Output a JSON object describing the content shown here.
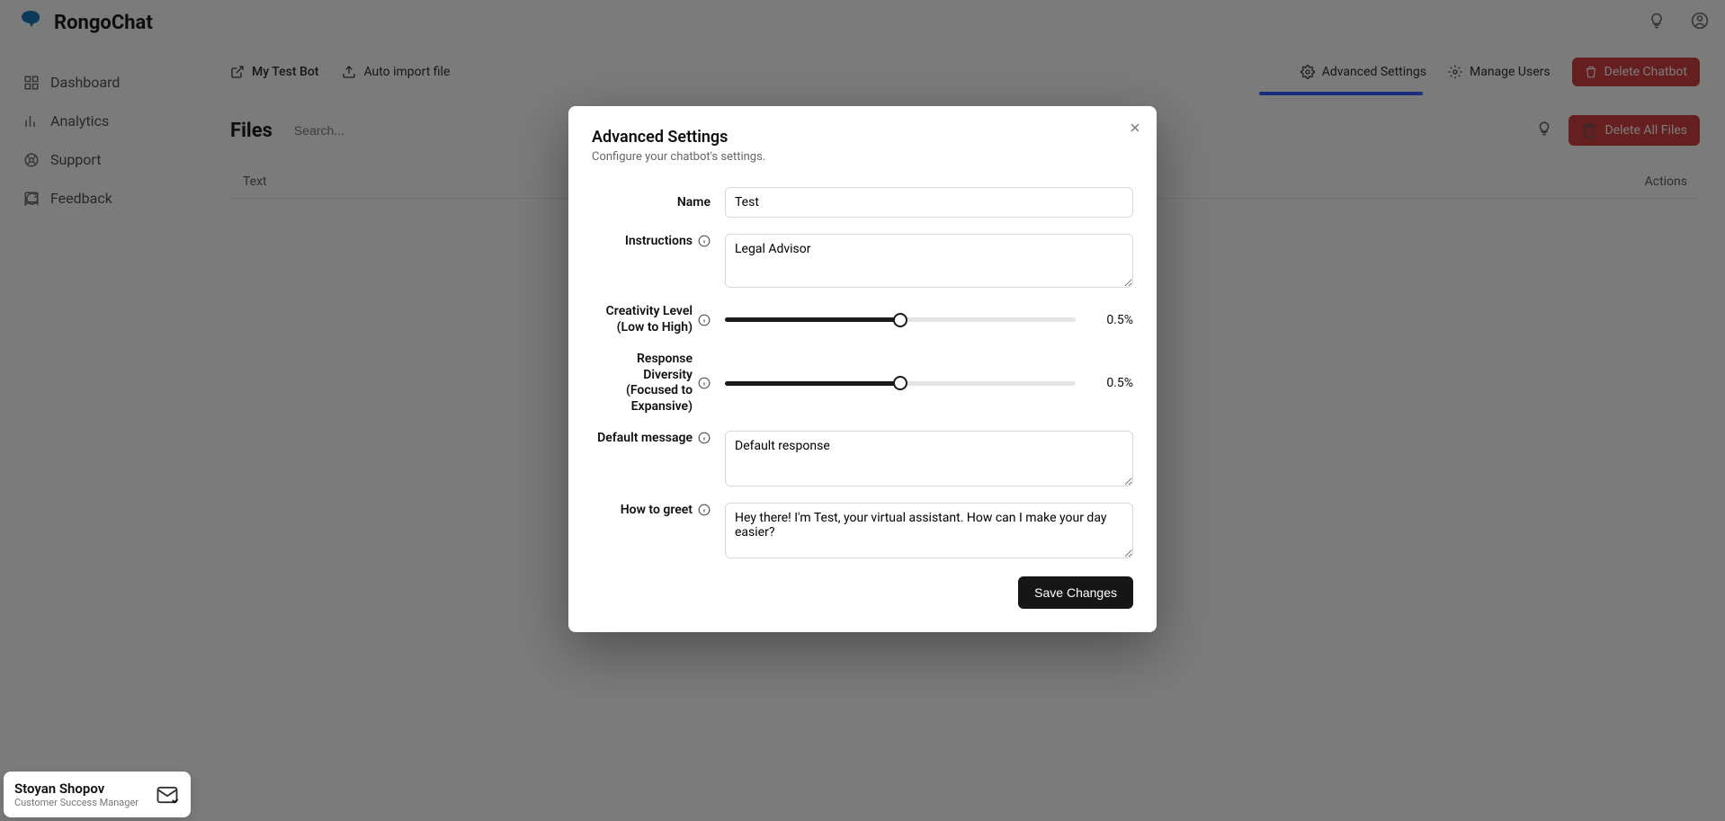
{
  "brand": {
    "name": "RongoChat"
  },
  "sidebar": {
    "items": [
      {
        "label": "Dashboard"
      },
      {
        "label": "Analytics"
      },
      {
        "label": "Support"
      },
      {
        "label": "Feedback"
      }
    ]
  },
  "header": {
    "bot_name": "My Test Bot",
    "auto_import": "Auto import file",
    "advanced_settings": "Advanced Settings",
    "manage_users": "Manage Users",
    "delete_chatbot": "Delete Chatbot"
  },
  "files": {
    "title": "Files",
    "search_placeholder": "Search...",
    "delete_all": "Delete All Files",
    "columns": {
      "text": "Text",
      "actions": "Actions"
    }
  },
  "modal": {
    "title": "Advanced Settings",
    "subtitle": "Configure your chatbot's settings.",
    "labels": {
      "name": "Name",
      "instructions": "Instructions",
      "creativity": "Creativity Level (Low to High)",
      "diversity": "Response Diversity (Focused to Expansive)",
      "default_message": "Default message",
      "how_to_greet": "How to greet"
    },
    "values": {
      "name": "Test",
      "instructions": "Legal Advisor",
      "creativity_pct": 50,
      "creativity_display": "0.5%",
      "diversity_pct": 50,
      "diversity_display": "0.5%",
      "default_message": "Default response",
      "how_to_greet": "Hey there! I'm Test, your virtual assistant. How can I make your day easier?"
    },
    "save": "Save Changes"
  },
  "csm": {
    "name": "Stoyan Shopov",
    "role": "Customer Success Manager"
  }
}
